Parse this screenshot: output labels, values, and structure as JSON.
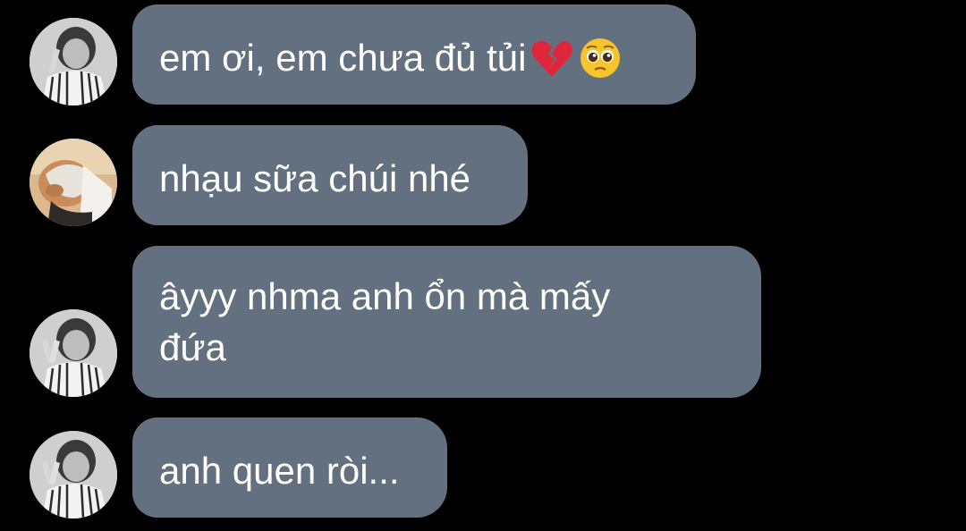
{
  "messages": [
    {
      "text": "em ơi, em chưa đủ tủi",
      "emojis": [
        "broken-heart-icon",
        "pleading-face-icon"
      ],
      "avatar": "avatar-boy-striped-shirt"
    },
    {
      "text": "nhạu sữa chúi nhé",
      "emojis": [],
      "avatar": "avatar-person-covering-face"
    },
    {
      "text_line1": "âyyy nhma anh ổn mà mấy",
      "text_line2": "đứa",
      "emojis": [],
      "avatar": "avatar-boy-striped-shirt"
    },
    {
      "text": "anh quen ròi...",
      "emojis": [],
      "avatar": "avatar-boy-striped-shirt"
    }
  ],
  "colors": {
    "background": "#000000",
    "bubble": "#63707f",
    "text": "#ffffff"
  }
}
